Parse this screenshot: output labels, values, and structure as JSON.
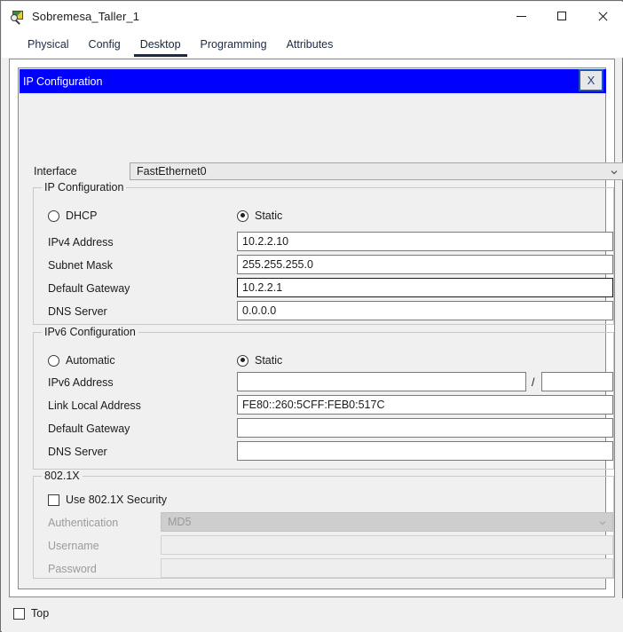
{
  "window": {
    "title": "Sobremesa_Taller_1",
    "icon": "packet-tracer-pc-icon",
    "controls": {
      "minimize": "—",
      "maximize": "□",
      "close": "✕"
    }
  },
  "tabs": [
    {
      "label": "Physical",
      "active": false
    },
    {
      "label": "Config",
      "active": false
    },
    {
      "label": "Desktop",
      "active": true
    },
    {
      "label": "Programming",
      "active": false
    },
    {
      "label": "Attributes",
      "active": false
    }
  ],
  "dialog": {
    "title": "IP Configuration",
    "close_label": "X",
    "title_bg": "#0000ff",
    "title_fg": "#ffffff"
  },
  "interface": {
    "label": "Interface",
    "value": "FastEthernet0"
  },
  "ipv4": {
    "group_label": "IP Configuration",
    "mode": {
      "dhcp_label": "DHCP",
      "dhcp_selected": false,
      "static_label": "Static",
      "static_selected": true
    },
    "fields": [
      {
        "label": "IPv4 Address",
        "value": "10.2.2.10",
        "focused": false
      },
      {
        "label": "Subnet Mask",
        "value": "255.255.255.0",
        "focused": false
      },
      {
        "label": "Default Gateway",
        "value": "10.2.2.1",
        "focused": true
      },
      {
        "label": "DNS Server",
        "value": "0.0.0.0",
        "focused": false
      }
    ]
  },
  "ipv6": {
    "group_label": "IPv6 Configuration",
    "mode": {
      "auto_label": "Automatic",
      "auto_selected": false,
      "static_label": "Static",
      "static_selected": true
    },
    "address": {
      "label": "IPv6 Address",
      "value": "",
      "separator": "/",
      "prefix": ""
    },
    "fields": [
      {
        "label": "Link Local Address",
        "value": "FE80::260:5CFF:FEB0:517C"
      },
      {
        "label": "Default Gateway",
        "value": ""
      },
      {
        "label": "DNS Server",
        "value": ""
      }
    ]
  },
  "dot1x": {
    "group_label": "802.1X",
    "use_label": "Use 802.1X Security",
    "use_checked": false,
    "auth_label": "Authentication",
    "auth_value": "MD5",
    "username_label": "Username",
    "username_value": "",
    "password_label": "Password",
    "password_value": ""
  },
  "footer": {
    "top_label": "Top",
    "top_checked": false
  }
}
